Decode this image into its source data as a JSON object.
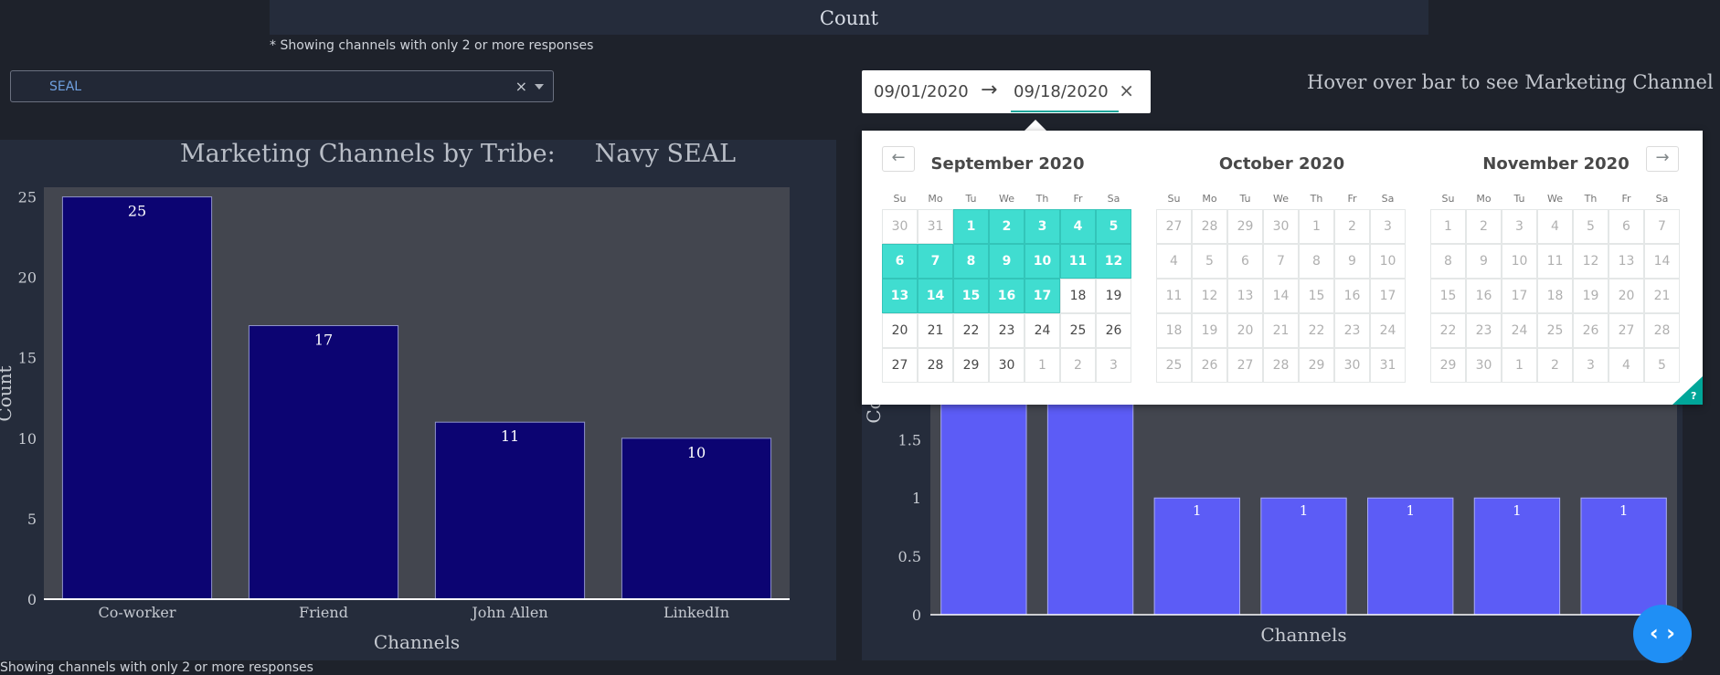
{
  "top_strip_label": "Count",
  "note_top": "* Showing channels with only 2 or more responses",
  "tribe_select": {
    "value": "SEAL",
    "clear": "×"
  },
  "left_chart_title": "Marketing Channels by Tribe:     Navy SEAL",
  "hover_hint": "Hover over bar to see Marketing Channel",
  "date_range": {
    "start": "09/01/2020",
    "arrow": "→",
    "end": "09/18/2020",
    "clear": "×"
  },
  "picker": {
    "prev": "←",
    "next": "→",
    "dow": [
      "Su",
      "Mo",
      "Tu",
      "We",
      "Th",
      "Fr",
      "Sa"
    ],
    "months": [
      {
        "title": "September 2020",
        "cells": [
          "30",
          "31",
          "1",
          "2",
          "3",
          "4",
          "5",
          "6",
          "7",
          "8",
          "9",
          "10",
          "11",
          "12",
          "13",
          "14",
          "15",
          "16",
          "17",
          "18",
          "19",
          "20",
          "21",
          "22",
          "23",
          "24",
          "25",
          "26",
          "27",
          "28",
          "29",
          "30",
          "1",
          "2",
          "3"
        ],
        "cur_range": [
          2,
          31
        ],
        "sel_range": [
          2,
          18
        ]
      },
      {
        "title": "October 2020",
        "cells": [
          "27",
          "28",
          "29",
          "30",
          "1",
          "2",
          "3",
          "4",
          "5",
          "6",
          "7",
          "8",
          "9",
          "10",
          "11",
          "12",
          "13",
          "14",
          "15",
          "16",
          "17",
          "18",
          "19",
          "20",
          "21",
          "22",
          "23",
          "24",
          "25",
          "26",
          "27",
          "28",
          "29",
          "30",
          "31"
        ],
        "cur_range": [
          -1,
          -1
        ],
        "sel_range": [
          -1,
          -1
        ]
      },
      {
        "title": "November 2020",
        "cells": [
          "1",
          "2",
          "3",
          "4",
          "5",
          "6",
          "7",
          "8",
          "9",
          "10",
          "11",
          "12",
          "13",
          "14",
          "15",
          "16",
          "17",
          "18",
          "19",
          "20",
          "21",
          "22",
          "23",
          "24",
          "25",
          "26",
          "27",
          "28",
          "29",
          "30",
          "1",
          "2",
          "3",
          "4",
          "5"
        ],
        "cur_range": [
          -1,
          -1
        ],
        "sel_range": [
          -1,
          -1
        ]
      }
    ],
    "help": "?"
  },
  "bottom_note": "Showing channels with only 2 or more responses",
  "code_button": "‹ ›",
  "chart_data": [
    {
      "type": "bar",
      "title": "Marketing Channels by Tribe:     Navy SEAL",
      "categories": [
        "Co-worker",
        "Friend",
        "John Allen",
        "LinkedIn"
      ],
      "values": [
        25,
        17,
        11,
        10
      ],
      "xlabel": "Channels",
      "ylabel": "Count",
      "ylim": [
        0,
        25.6
      ],
      "yticks": [
        "0",
        "5",
        "10",
        "15",
        "20",
        "25"
      ],
      "bar_color": "#0c0472"
    },
    {
      "type": "bar",
      "title": "",
      "categories": [
        "",
        "",
        "",
        "",
        "",
        "",
        ""
      ],
      "values": [
        2,
        2,
        1,
        1,
        1,
        1,
        1
      ],
      "data_labels": [
        "",
        "",
        "1",
        "1",
        "1",
        "1",
        "1"
      ],
      "xlabel": "Channels",
      "ylabel": "Co",
      "ylim": [
        0,
        1.98
      ],
      "yticks": [
        "0",
        "0.5",
        "1",
        "1.5"
      ],
      "bar_color": "#5c5cf6"
    }
  ]
}
